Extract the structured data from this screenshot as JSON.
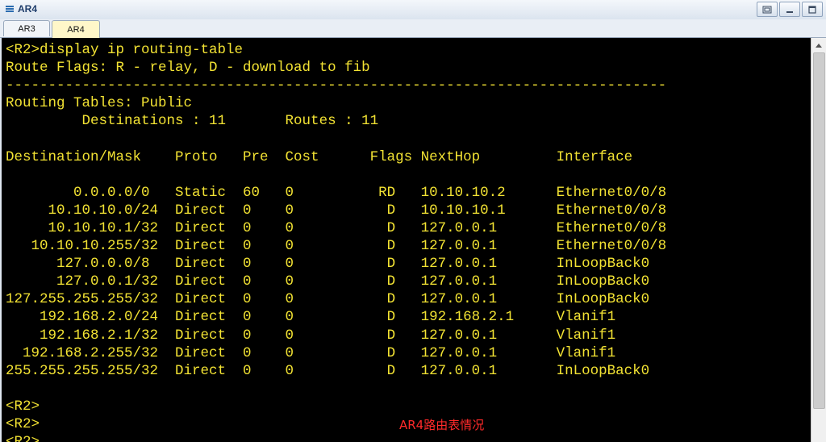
{
  "window": {
    "title": "AR4",
    "icon": "router-icon",
    "controls": [
      "restore-icon",
      "minimize-icon",
      "maximize-icon"
    ]
  },
  "tabs": [
    {
      "label": "AR3",
      "active": false
    },
    {
      "label": "AR4",
      "active": true
    }
  ],
  "terminal": {
    "text_color": "#f2e233",
    "background": "#000000",
    "lines": [
      "<R2>display ip routing-table",
      "Route Flags: R - relay, D - download to fib",
      "------------------------------------------------------------------------------",
      "Routing Tables: Public",
      "         Destinations : 11       Routes : 11",
      "",
      "Destination/Mask    Proto   Pre  Cost      Flags NextHop         Interface",
      "",
      "        0.0.0.0/0   Static  60   0          RD   10.10.10.2      Ethernet0/0/8",
      "     10.10.10.0/24  Direct  0    0           D   10.10.10.1      Ethernet0/0/8",
      "     10.10.10.1/32  Direct  0    0           D   127.0.0.1       Ethernet0/0/8",
      "   10.10.10.255/32  Direct  0    0           D   127.0.0.1       Ethernet0/0/8",
      "      127.0.0.0/8   Direct  0    0           D   127.0.0.1       InLoopBack0",
      "      127.0.0.1/32  Direct  0    0           D   127.0.0.1       InLoopBack0",
      "127.255.255.255/32  Direct  0    0           D   127.0.0.1       InLoopBack0",
      "    192.168.2.0/24  Direct  0    0           D   192.168.2.1     Vlanif1",
      "    192.168.2.1/32  Direct  0    0           D   127.0.0.1       Vlanif1",
      "  192.168.2.255/32  Direct  0    0           D   127.0.0.1       Vlanif1",
      "255.255.255.255/32  Direct  0    0           D   127.0.0.1       InLoopBack0",
      "",
      "<R2>",
      "<R2>",
      "<R2>"
    ]
  },
  "caption": {
    "text": "AR4路由表情况",
    "color": "#ff2a2a"
  }
}
